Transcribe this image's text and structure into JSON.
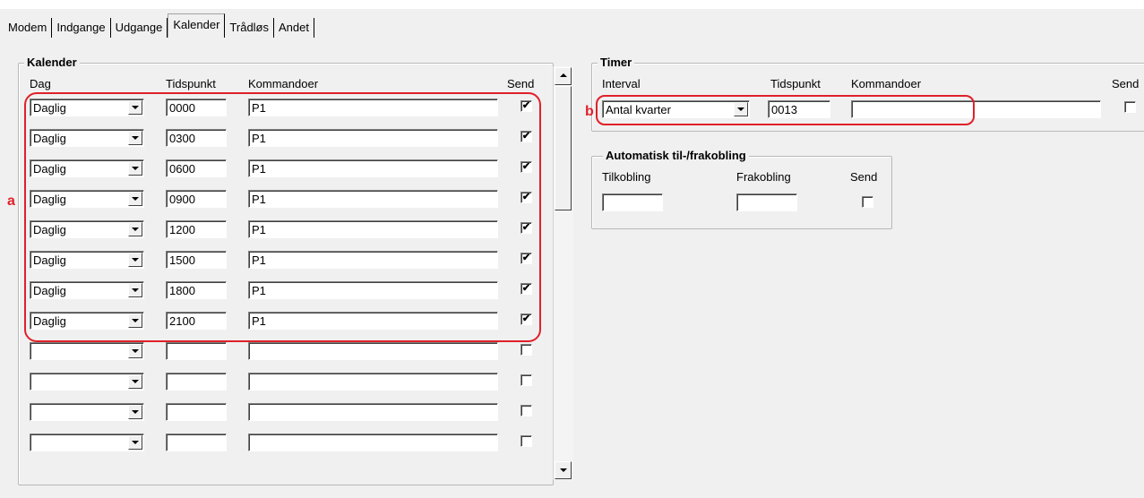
{
  "tabs": [
    "Modem",
    "Indgange",
    "Udgange",
    "Kalender",
    "Trådløs",
    "Andet"
  ],
  "active_tab": "Kalender",
  "kalender": {
    "title": "Kalender",
    "headers": {
      "dag": "Dag",
      "tid": "Tidspunkt",
      "kom": "Kommandoer",
      "send": "Send"
    },
    "rows": [
      {
        "dag": "Daglig",
        "tid": "0000",
        "kom": "P1",
        "send": "✔"
      },
      {
        "dag": "Daglig",
        "tid": "0300",
        "kom": "P1",
        "send": "✔"
      },
      {
        "dag": "Daglig",
        "tid": "0600",
        "kom": "P1",
        "send": "✔"
      },
      {
        "dag": "Daglig",
        "tid": "0900",
        "kom": "P1",
        "send": "✔"
      },
      {
        "dag": "Daglig",
        "tid": "1200",
        "kom": "P1",
        "send": "✔"
      },
      {
        "dag": "Daglig",
        "tid": "1500",
        "kom": "P1",
        "send": "✔"
      },
      {
        "dag": "Daglig",
        "tid": "1800",
        "kom": "P1",
        "send": "✔"
      },
      {
        "dag": "Daglig",
        "tid": "2100",
        "kom": "P1",
        "send": "✔"
      },
      {
        "dag": "",
        "tid": "",
        "kom": "",
        "send": ""
      },
      {
        "dag": "",
        "tid": "",
        "kom": "",
        "send": ""
      },
      {
        "dag": "",
        "tid": "",
        "kom": "",
        "send": ""
      },
      {
        "dag": "",
        "tid": "",
        "kom": "",
        "send": ""
      }
    ]
  },
  "timer": {
    "title": "Timer",
    "headers": {
      "interval": "Interval",
      "tid": "Tidspunkt",
      "kom": "Kommandoer",
      "send": "Send"
    },
    "interval": "Antal kvarter",
    "tid": "0013",
    "kom": "",
    "send": ""
  },
  "auto": {
    "title": "Automatisk til-/frakobling",
    "headers": {
      "til": "Tilkobling",
      "fra": "Frakobling",
      "send": "Send"
    },
    "til": "",
    "fra": "",
    "send": ""
  },
  "callouts": {
    "a": "a",
    "b": "b"
  },
  "colors": {
    "highlight": "#e0202a",
    "background": "#f0f0f0"
  },
  "icons": {
    "combo": "chevron-down-icon",
    "scroll_up": "arrow-up-icon",
    "scroll_down": "arrow-down-icon"
  }
}
